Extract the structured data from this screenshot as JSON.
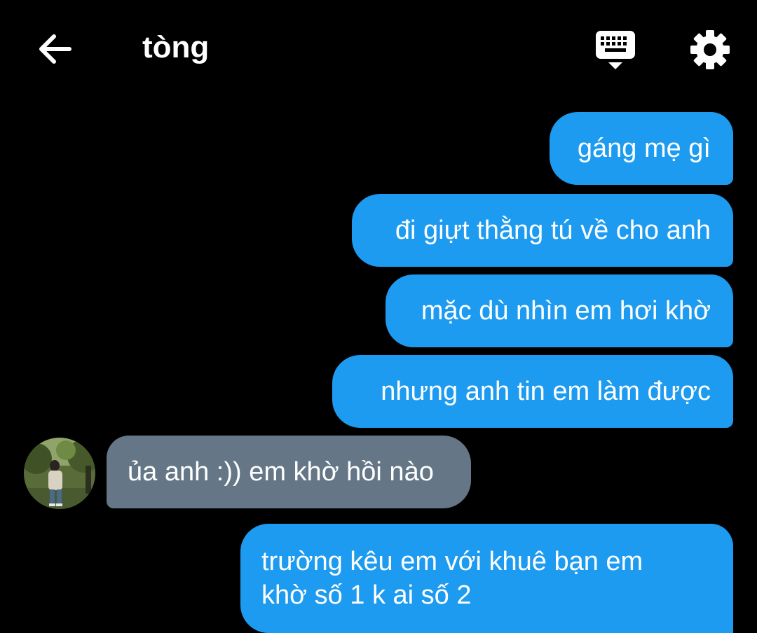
{
  "header": {
    "title": "tòng"
  },
  "icons": {
    "back": "arrow-left-icon",
    "keyboard": "keyboard-icon",
    "settings": "gear-icon"
  },
  "colors": {
    "background": "#000000",
    "outgoing_bubble": "#1d9bf0",
    "incoming_bubble": "#657786",
    "text": "#ffffff"
  },
  "messages": [
    {
      "direction": "outgoing",
      "text": "gáng mẹ gì"
    },
    {
      "direction": "outgoing",
      "text": "đi giựt thằng tú về cho anh"
    },
    {
      "direction": "outgoing",
      "text": "mặc dù nhìn em hơi khờ"
    },
    {
      "direction": "outgoing",
      "text": "nhưng anh tin em làm được"
    },
    {
      "direction": "incoming",
      "text": "ủa anh :)) em khờ hồi nào"
    },
    {
      "direction": "outgoing",
      "lines": [
        "trường kêu em với khuê bạn em",
        "khờ số 1 k ai số 2"
      ]
    }
  ]
}
